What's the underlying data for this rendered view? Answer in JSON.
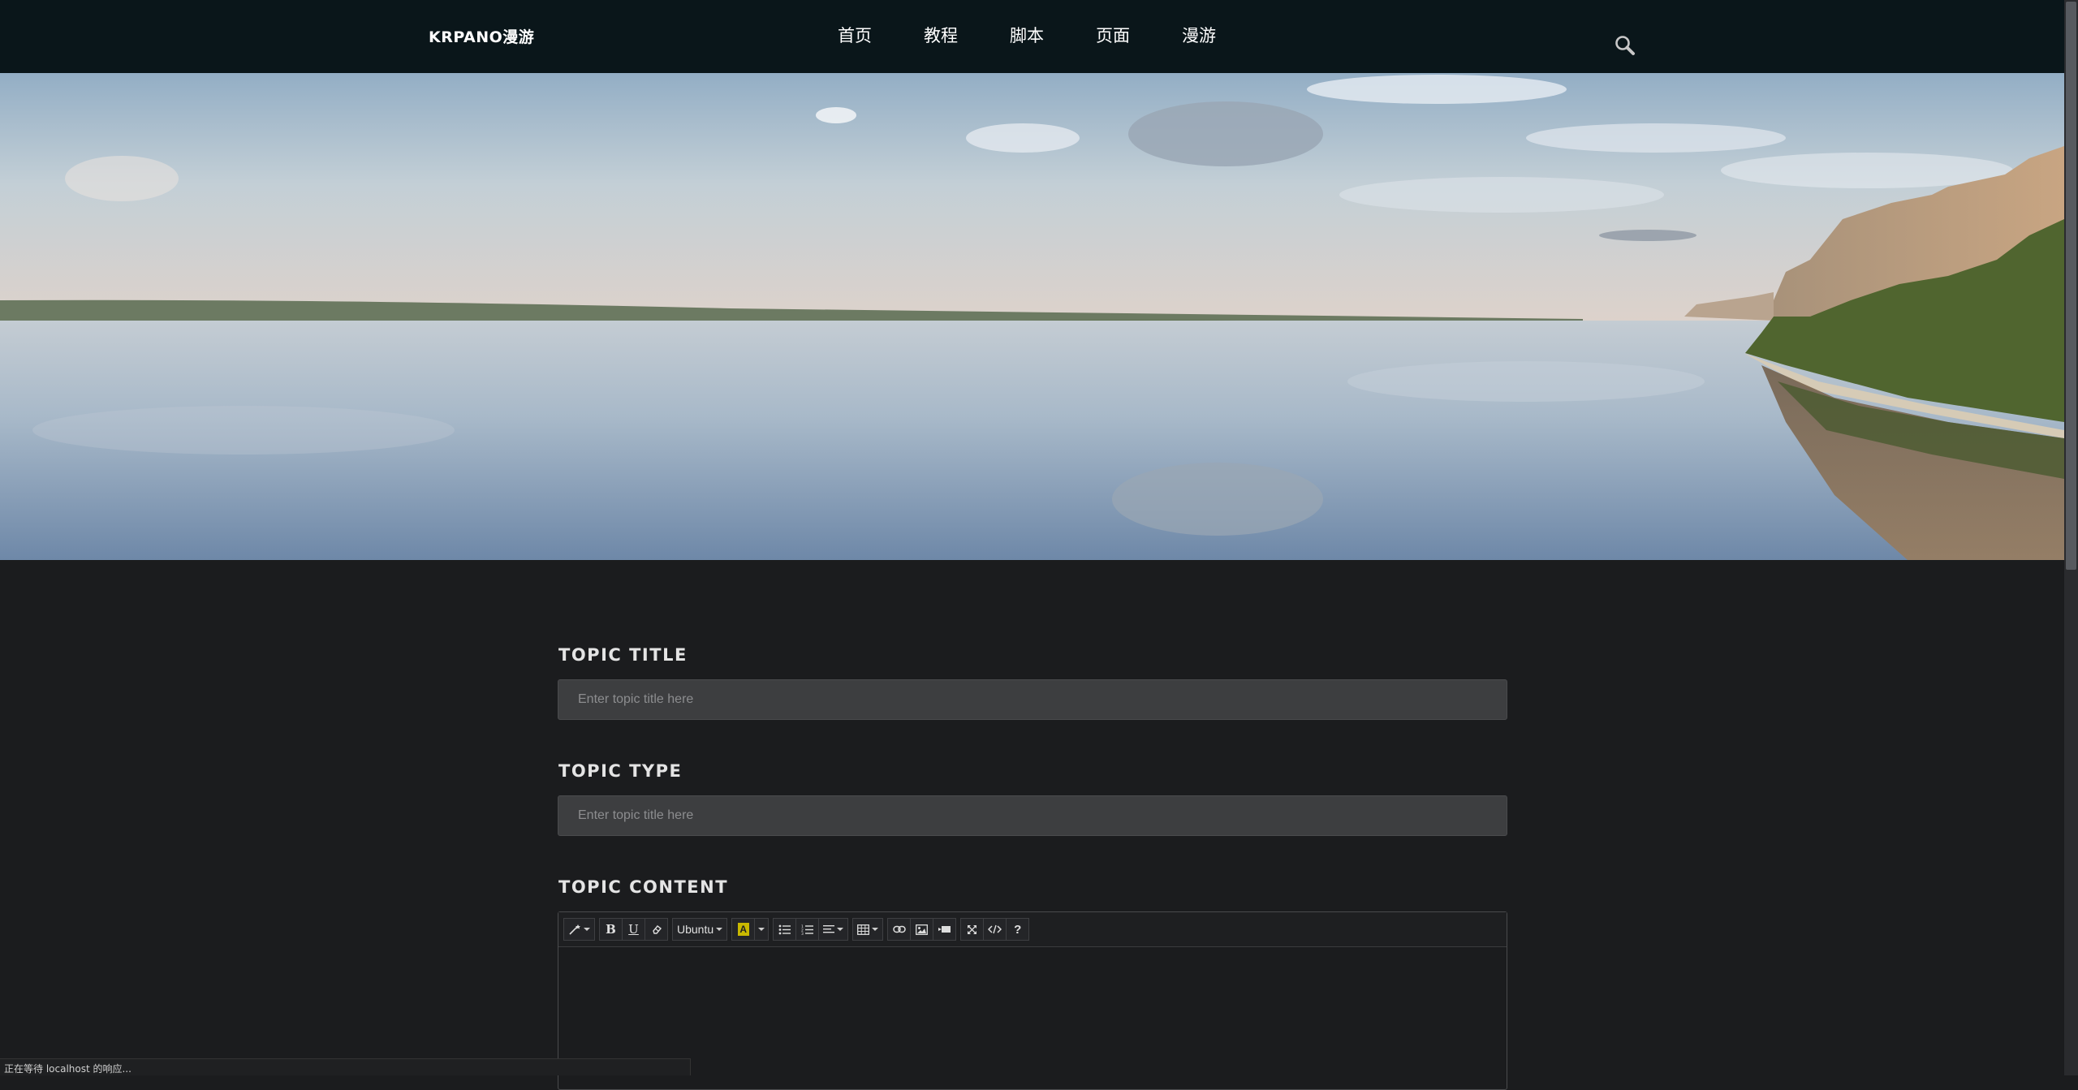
{
  "brand": "KRPANO漫游",
  "nav": {
    "items": [
      "首页",
      "教程",
      "脚本",
      "页面",
      "漫游"
    ],
    "search_icon": "search-icon"
  },
  "hero": {
    "image": "panorama of a calm river with cliffs and forest on the right bank"
  },
  "form": {
    "title_label": "TOPIC TITLE",
    "title_placeholder": "Enter topic title here",
    "type_label": "TOPIC TYPE",
    "type_placeholder": "Enter topic title here",
    "content_label": "TOPIC CONTENT"
  },
  "editor": {
    "font_name": "Ubuntu",
    "toolbar_icons": [
      "magic-wand-icon",
      "bold-icon",
      "underline-icon",
      "eraser-icon",
      "font-color-icon",
      "bullet-list-icon",
      "numbered-list-icon",
      "align-icon",
      "table-icon",
      "link-icon",
      "image-icon",
      "video-icon",
      "fullscreen-icon",
      "code-view-icon",
      "help-icon"
    ]
  },
  "status_text": "正在等待 localhost 的响应...",
  "colors": {
    "navbar_bg": "#0a161a",
    "page_bg": "#1b1c1e",
    "input_bg": "#3d3e40",
    "highlight_yellow": "#c9b800"
  }
}
